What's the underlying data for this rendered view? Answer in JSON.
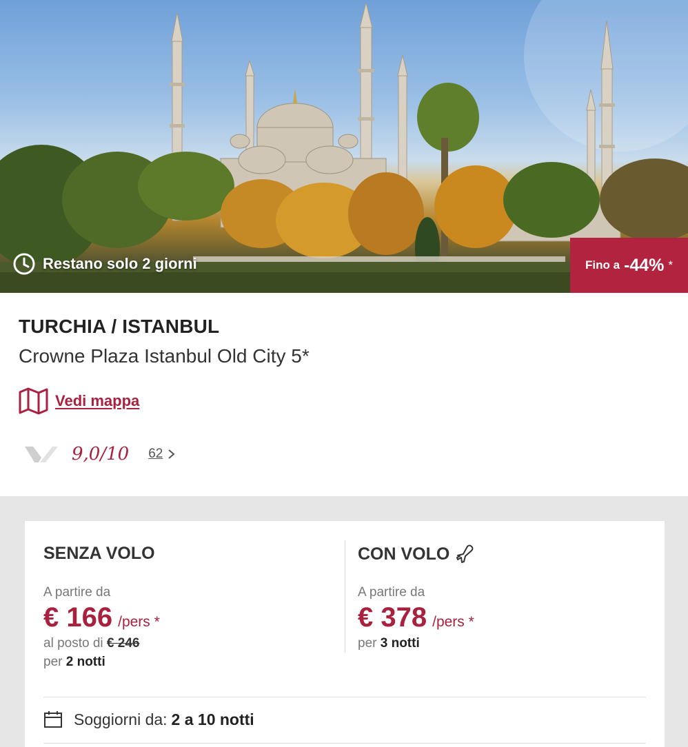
{
  "hero": {
    "timer_text": "Restano solo 2 giorni",
    "discount": {
      "prefix": "Fino a",
      "percent": "-44%",
      "asterisk": "*"
    }
  },
  "info": {
    "country_city": "TURCHIA / ISTANBUL",
    "hotel_name": "Crowne Plaza Istanbul Old City 5*",
    "map_link": "Vedi mappa",
    "rating": {
      "score": "9,0/10",
      "reviews_count": "62"
    }
  },
  "offers": {
    "without_flight": {
      "title": "SENZA VOLO",
      "from_label": "A partire da",
      "price": "€ 166",
      "per_person": "/pers *",
      "instead_of_label": "al posto di",
      "old_price": "€ 246",
      "per_label": "per",
      "nights": "2 notti"
    },
    "with_flight": {
      "title": "CON VOLO",
      "from_label": "A partire da",
      "price": "€ 378",
      "per_person": "/pers *",
      "per_label": "per",
      "nights": "3 notti"
    },
    "stay": {
      "label": "Soggiorni da:",
      "value": "2 a 10 notti"
    }
  },
  "colors": {
    "accent": "#a8213e",
    "badge": "#b1233f",
    "background_grey": "#e6e6e6"
  },
  "icons": [
    "clock-icon",
    "map-icon",
    "provider-logo-icon",
    "chevron-right-icon",
    "plane-icon",
    "calendar-icon"
  ]
}
